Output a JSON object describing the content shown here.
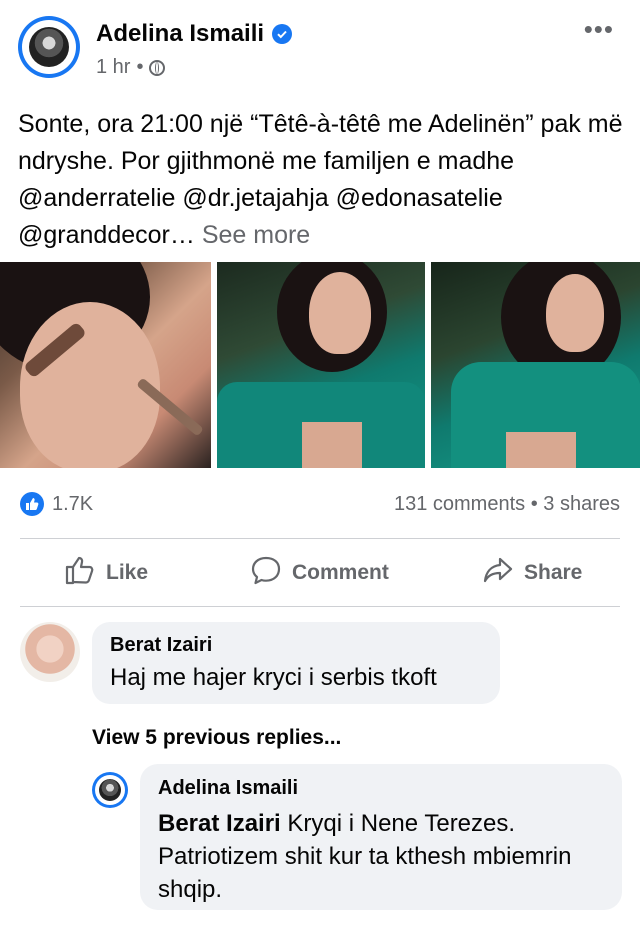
{
  "post": {
    "author": "Adelina Ismaili",
    "time": "1 hr",
    "separator": "•",
    "text_main": "Sonte, ora 21:00 një “Têtê-à-têtê me Adelinën” pak më ndryshe. Por gjithmonë me familjen e madhe @anderratelie @dr.jetajahja @edonasatelie @granddecor…",
    "see_more": "See more",
    "more_menu": "•••"
  },
  "reactions": {
    "likes": "1.7K",
    "comments": "131 comments",
    "dot": "•",
    "shares": "3 shares"
  },
  "actions": {
    "like": "Like",
    "comment": "Comment",
    "share": "Share"
  },
  "comments": [
    {
      "name": "Berat Izairi",
      "text": "Haj me hajer kryci i serbis tkoft"
    }
  ],
  "view_replies": "View 5 previous replies...",
  "reply": {
    "name": "Adelina Ismaili",
    "mention": "Berat Izairi",
    "text": " Kryqi i Nene Terezes. Patriotizem shit kur ta kthesh mbiemrin shqip."
  },
  "colors": {
    "accent": "#1877f2",
    "muted": "#65676b",
    "bubble": "#f0f2f5"
  }
}
